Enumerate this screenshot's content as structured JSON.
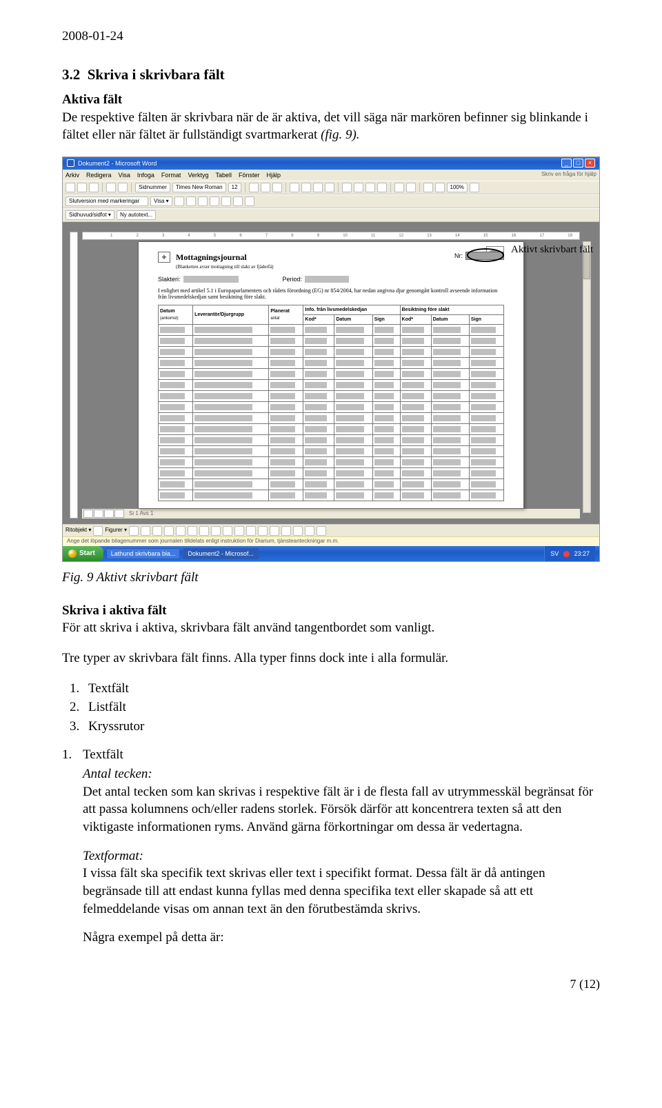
{
  "date": "2008-01-24",
  "section_number": "3.2",
  "section_title": "Skriva i skrivbara fält",
  "subtitle1": "Aktiva fält",
  "para1": "De respektive fälten är skrivbara när de är aktiva, det vill säga när markören befinner sig blinkande i fältet eller när fältet är fullständigt svartmarkerat ",
  "para1_italic": "(fig. 9).",
  "callout_label": "Aktivt skrivbart  fält",
  "fig_caption": "Fig. 9 Aktivt skrivbart fält",
  "subtitle2": "Skriva i aktiva fält",
  "para2": "För att skriva i aktiva, skrivbara fält använd tangentbordet som vanligt.",
  "para3": "Tre typer av skrivbara fält finns. Alla typer finns dock inte i alla formulär.",
  "list1": {
    "i1": "Textfält",
    "i2": "Listfält",
    "i3": "Kryssrutor"
  },
  "li_num": "1.",
  "li_title": "Textfält",
  "antal_label": "Antal tecken:",
  "antal_text": "Det antal tecken som kan skrivas i respektive fält är i de flesta fall av utrymmesskäl begränsat för att passa kolumnens och/eller radens storlek. Försök därför att koncentrera texten så att den viktigaste informationen ryms. Använd gärna förkortningar om dessa är vedertagna.",
  "textformat_label": "Textformat:",
  "textformat_text": "I vissa fält ska specifik text skrivas eller text i specifikt format. Dessa fält är då antingen begränsade till att endast kunna fyllas med denna specifika text eller skapade så att ett felmeddelande visas om annan text än den förutbestämda skrivs.",
  "para4": "Några exempel på detta är:",
  "page_number": "7 (12)",
  "word": {
    "title": "Dokument2 - Microsoft Word",
    "menu": {
      "arkiv": "Arkiv",
      "redigera": "Redigera",
      "visa": "Visa",
      "infoga": "Infoga",
      "format": "Format",
      "verktyg": "Verktyg",
      "tabell": "Tabell",
      "fonster": "Fönster",
      "hjalp": "Hjälp",
      "help_hint": "Skriv en fråga för hjälp"
    },
    "toolbar2": {
      "style_lbl": "Slutversion med markeringar",
      "visa": "Visa ▾"
    },
    "toolbar3_left": "Sidhuvud/sidfot ▾",
    "toolbar3_right": "Ny autotext...",
    "font": "Times New Roman",
    "fontsize": "12",
    "zoom": "100%",
    "doc": {
      "title": "Mottagningsjournal",
      "sub": "(Blanketten avser mottagning till slakt av fjäderfä)",
      "nr_label": "Nr:",
      "slakteri_label": "Slakteri:",
      "period_label": "Period:",
      "intro": "I enlighet med artikel 5.1 i Europaparlamentets och rådets förordning (EG) nr 854/2004, har nedan angivna djur genomgått kontroll avseende information från livsmedelskedjan samt besiktning före slakt.",
      "th1": "Datum",
      "th1b": "(ankomst)",
      "th2": "Leverantör/Djurgrupp",
      "th3": "Planerat",
      "th3b": "antal",
      "th4a": "Info. från livsmedelskedjan",
      "th4k": "Kod*",
      "th4d": "Datum",
      "th4s": "Sign",
      "th5a": "Besiktning före slakt",
      "th5k": "Kod*",
      "th5d": "Datum",
      "th5s": "Sign"
    },
    "status": {
      "ritobj": "Ritobjekt ▾",
      "figurer": "Figurer ▾"
    },
    "hint": "Ange det löpande bilagenummer som journalen tilldelats enligt instruktion för Diarium, tjänsteanteckningar m.m.",
    "views_row": "Si 1    Avs 1",
    "taskbar": {
      "start": "Start",
      "item1": "Lathund skrivbara bla...",
      "item2": "Dokument2 - Microsof...",
      "lang": "SV",
      "time": "23:27"
    }
  }
}
